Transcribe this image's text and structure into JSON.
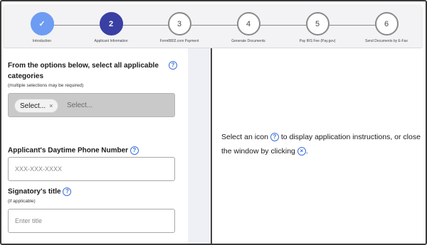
{
  "stepper": {
    "steps": [
      {
        "number": "✓",
        "label": "Introduction",
        "state": "done"
      },
      {
        "number": "2",
        "label": "Applicant Information",
        "state": "active"
      },
      {
        "number": "3",
        "label": "Form8802.com Payment",
        "state": "todo"
      },
      {
        "number": "4",
        "label": "Generate Documents",
        "state": "todo"
      },
      {
        "number": "5",
        "label": "Pay IRS Fee (Pay.gov)",
        "state": "todo"
      },
      {
        "number": "6",
        "label": "Send Documents by E-Fax",
        "state": "todo"
      }
    ]
  },
  "form": {
    "categories": {
      "title": "From the options below, select all applicable categories",
      "subtitle": "(multiple selections may be required)",
      "chip_label": "Select...",
      "chip_remove": "×",
      "placeholder": "Select..."
    },
    "phone": {
      "label": "Applicant's Daytime Phone Number",
      "placeholder": "XXX-XXX-XXXX"
    },
    "signatory": {
      "label": "Signatory's title",
      "subtitle": "(if applicable)",
      "placeholder": "Enter title"
    },
    "help_glyph": "?"
  },
  "instructions": {
    "part1": "Select an icon",
    "part2": "to display application instructions, or close the window by clicking",
    "part3": ".",
    "help_glyph": "?",
    "close_glyph": "×"
  },
  "colors": {
    "done_step": "#6d9cf2",
    "active_step": "#3a3fa4",
    "help_icon": "#3b6fd8"
  }
}
